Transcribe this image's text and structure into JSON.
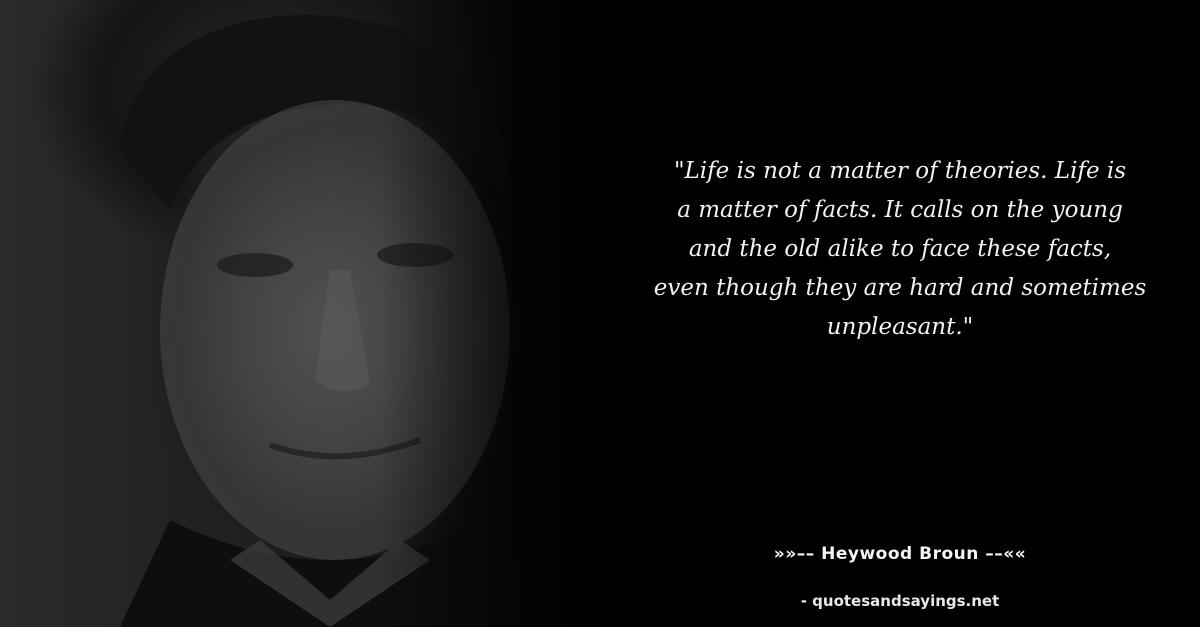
{
  "quote": {
    "text": "\"Life is not a matter of theories. Life is\na matter of facts. It calls on the young\nand the old alike to face these facts,\neven though they are hard and sometimes\nunpleasant.\""
  },
  "attribution": {
    "author_line": "»»–– Heywood Broun ––««",
    "source": "- quotesandsayings.net"
  },
  "colors": {
    "background": "#000000",
    "text": "#f2f2f2"
  }
}
